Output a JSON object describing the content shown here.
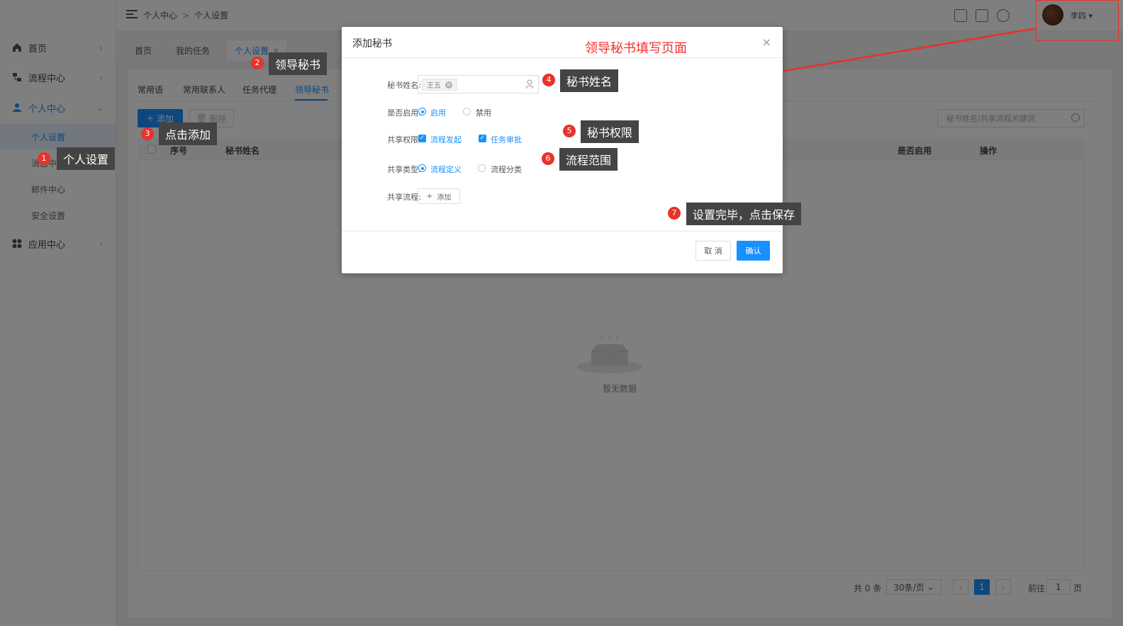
{
  "breadcrumb": [
    "个人中心",
    "个人设置"
  ],
  "user": {
    "name": "李四"
  },
  "sidebar": {
    "items": [
      {
        "label": "首页"
      },
      {
        "label": "流程中心"
      },
      {
        "label": "个人中心"
      },
      {
        "label": "应用中心"
      }
    ],
    "submenu": [
      "个人设置",
      "消息中心",
      "邮件中心",
      "安全设置"
    ]
  },
  "tabs": [
    {
      "label": "首页"
    },
    {
      "label": "我的任务"
    },
    {
      "label": "个人设置"
    }
  ],
  "subtabs": [
    "常用语",
    "常用联系人",
    "任务代理",
    "领导秘书"
  ],
  "toolbar": {
    "add": "添加",
    "delete": "删除",
    "search_placeholder": "秘书姓名/共享流程关键词"
  },
  "table": {
    "columns": [
      "序号",
      "秘书姓名",
      "是否启用",
      "操作"
    ],
    "empty": "暂无数据"
  },
  "pagination": {
    "total": "共 0 条",
    "page_size": "30条/页",
    "current": "1",
    "goto_prefix": "前往",
    "goto_value": "1",
    "goto_suffix": "页"
  },
  "dialog": {
    "title": "添加秘书",
    "note": "领导秘书填写页面",
    "fields": {
      "name_label": "秘书姓名:",
      "name_tag": "王五",
      "enabled_label": "是否启用:",
      "enabled_on": "启用",
      "enabled_off": "禁用",
      "perm_label": "共享权限:",
      "perm_start": "流程发起",
      "perm_approve": "任务审批",
      "type_label": "共享类型:",
      "type_def": "流程定义",
      "type_cat": "流程分类",
      "flow_label": "共享流程:",
      "flow_add": "添加"
    },
    "cancel": "取 消",
    "confirm": "确认"
  },
  "callouts": [
    {
      "num": "1",
      "text": "个人设置"
    },
    {
      "num": "2",
      "text": "领导秘书"
    },
    {
      "num": "3",
      "text": "点击添加"
    },
    {
      "num": "4",
      "text": "秘书姓名"
    },
    {
      "num": "5",
      "text": "秘书权限"
    },
    {
      "num": "6",
      "text": "流程范围"
    },
    {
      "num": "7",
      "text": "设置完毕，点击保存"
    }
  ],
  "colors": {
    "accent": "#1890ff",
    "annotation_red": "#e8322a"
  }
}
